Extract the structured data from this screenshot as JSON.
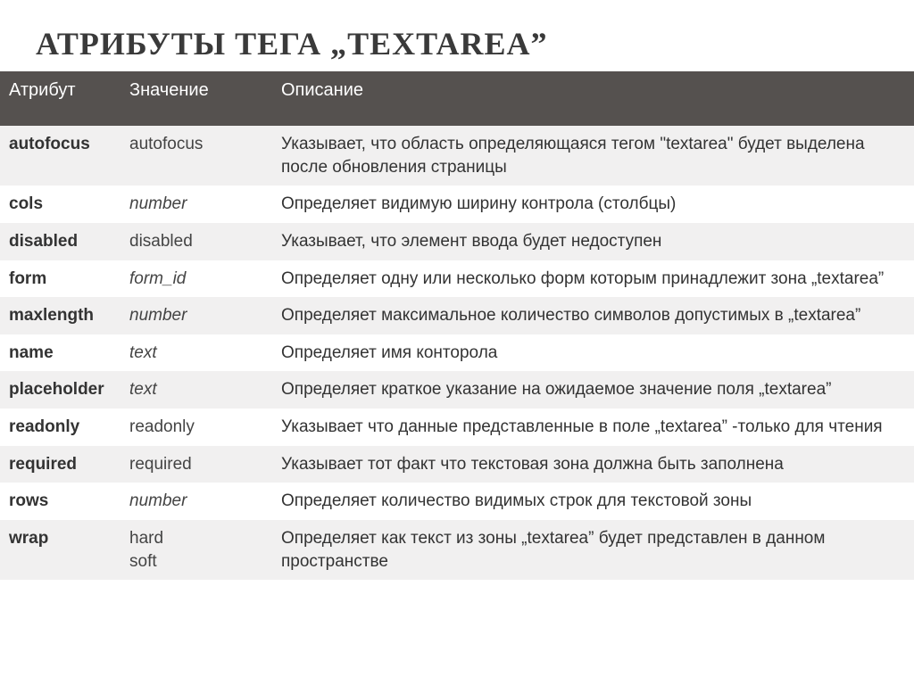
{
  "title": "АТРИБУТЫ ТЕГА  „TEXTAREA”",
  "headers": {
    "attribute": "Атрибут",
    "value": "Значение",
    "description": "Описание"
  },
  "rows": [
    {
      "attr": "autofocus",
      "value": "autofocus",
      "valueItalic": false,
      "desc": "Указывает, что область определяющаяся  тегом \"textarea\" будет выделена после обновления страницы"
    },
    {
      "attr": "cols",
      "value": "number",
      "valueItalic": true,
      "desc": "Определяет видимую ширину контрола (столбцы)"
    },
    {
      "attr": "disabled",
      "value": "disabled",
      "valueItalic": false,
      "desc": "Указывает, что элемент ввода будет недоступен"
    },
    {
      "attr": "form",
      "value": "form_id",
      "valueItalic": true,
      "desc": "Определяет одну или несколько форм которым принадлежит зона  „textarea”"
    },
    {
      "attr": "maxlength",
      "value": "number",
      "valueItalic": true,
      "desc": "Определяет максимальное количество символов допустимых в „textarea”"
    },
    {
      "attr": "name",
      "value": "text",
      "valueItalic": true,
      "desc": "Определяет имя конторола"
    },
    {
      "attr": "placeholder",
      "value": "text",
      "valueItalic": true,
      "desc": "Определяет  краткое указание на ожидаемое значение поля „textarea”"
    },
    {
      "attr": "readonly",
      "value": "readonly",
      "valueItalic": false,
      "desc": "Указывает что данные представленные в поле „textarea” -только для чтения"
    },
    {
      "attr": "required",
      "value": "required",
      "valueItalic": false,
      "desc": "Указывает тот факт что текстовая зона должна быть заполнена"
    },
    {
      "attr": "rows",
      "value": "number",
      "valueItalic": true,
      "desc": "Определяет количество видимых строк для текстовой зоны"
    },
    {
      "attr": "wrap",
      "value": "hard\nsoft",
      "valueItalic": false,
      "desc": "Определяет как текст из зоны „textarea” будет представлен в данном пространстве"
    }
  ]
}
